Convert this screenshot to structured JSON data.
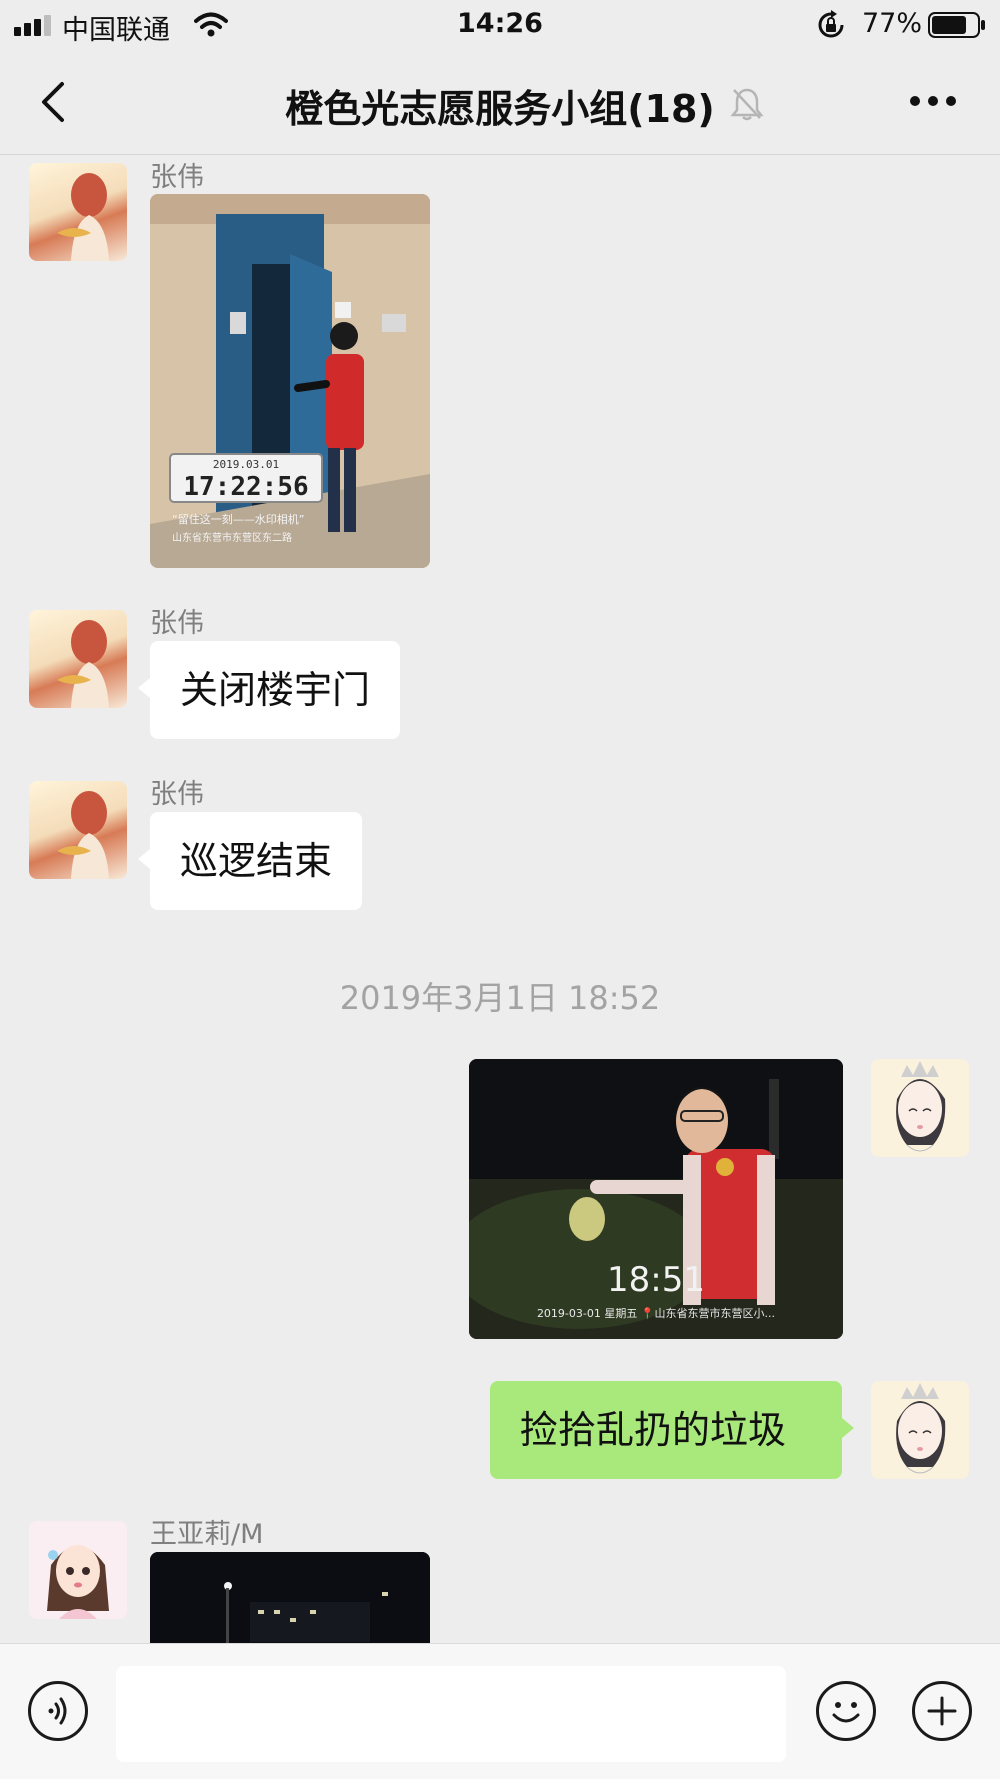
{
  "status_bar": {
    "carrier": "中国联通",
    "time": "14:26",
    "battery_percent": "77%",
    "signal_bars": 3,
    "signal_bars_total": 4,
    "battery_level": 0.77
  },
  "nav": {
    "title": "橙色光志愿服务小组(18)",
    "back_icon": "chevron-left-icon",
    "mute_icon": "bell-off-icon",
    "more_icon": "more-dots-icon"
  },
  "messages": [
    {
      "sender": "张伟",
      "type": "image",
      "overlay": {
        "date": "2019.03.01",
        "time": "17:22:56",
        "caption": "“留住这一刻——水印相机”",
        "location": "山东省东营市东营区东二路"
      }
    },
    {
      "sender": "张伟",
      "type": "text",
      "text": "关闭楼宇门"
    },
    {
      "sender": "张伟",
      "type": "text",
      "text": "巡逻结束"
    }
  ],
  "timestamp": "2019年3月1日 18:52",
  "my_messages": [
    {
      "type": "image",
      "overlay": {
        "time": "18:51",
        "info": "2019-03-01  星期五 📍山东省东营市东营区小..."
      }
    },
    {
      "type": "text",
      "text": "捡拾乱扔的垃圾"
    }
  ],
  "last_message": {
    "sender": "王亚莉/M",
    "type": "image"
  },
  "input_bar": {
    "voice_icon": "voice-icon",
    "emoji_icon": "emoji-icon",
    "plus_icon": "plus-icon",
    "input_value": ""
  },
  "colors": {
    "background": "#ededed",
    "bubble_incoming": "#ffffff",
    "bubble_outgoing": "#a9e97c",
    "vest_red": "#c9282a"
  }
}
